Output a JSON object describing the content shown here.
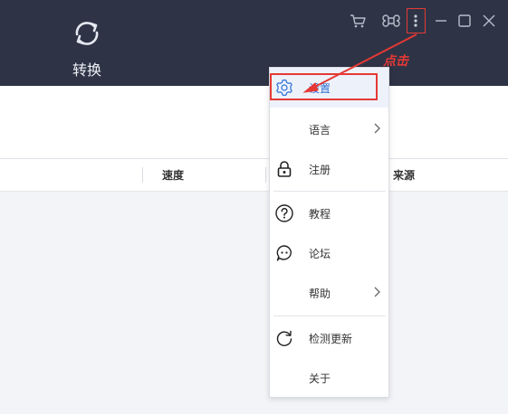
{
  "title_bar": {
    "convert_tab": {
      "label": "转换",
      "icon": "sync-icon"
    },
    "window_buttons": [
      {
        "name": "cart-icon"
      },
      {
        "name": "command-icon"
      },
      {
        "name": "more-vertical-icon"
      },
      {
        "name": "minimize-icon"
      },
      {
        "name": "maximize-icon"
      },
      {
        "name": "close-icon"
      }
    ]
  },
  "table": {
    "columns": [
      "速度",
      "来源"
    ]
  },
  "menu": {
    "items": [
      {
        "label": "设置",
        "icon": "gear-icon",
        "active": true
      },
      {
        "label": "语言",
        "submenu": true
      },
      {
        "label": "注册",
        "icon": "lock-icon"
      },
      {
        "label": "教程",
        "icon": "question-icon"
      },
      {
        "label": "论坛",
        "icon": "chat-icon"
      },
      {
        "label": "帮助",
        "submenu": true
      },
      {
        "label": "检测更新",
        "icon": "refresh-icon"
      },
      {
        "label": "关于"
      }
    ]
  },
  "annotation": {
    "text": "点击",
    "color": "#e53935"
  },
  "colors": {
    "title_bar": "#2e3446",
    "accent": "#2f6fd6",
    "highlight": "#e53935"
  }
}
